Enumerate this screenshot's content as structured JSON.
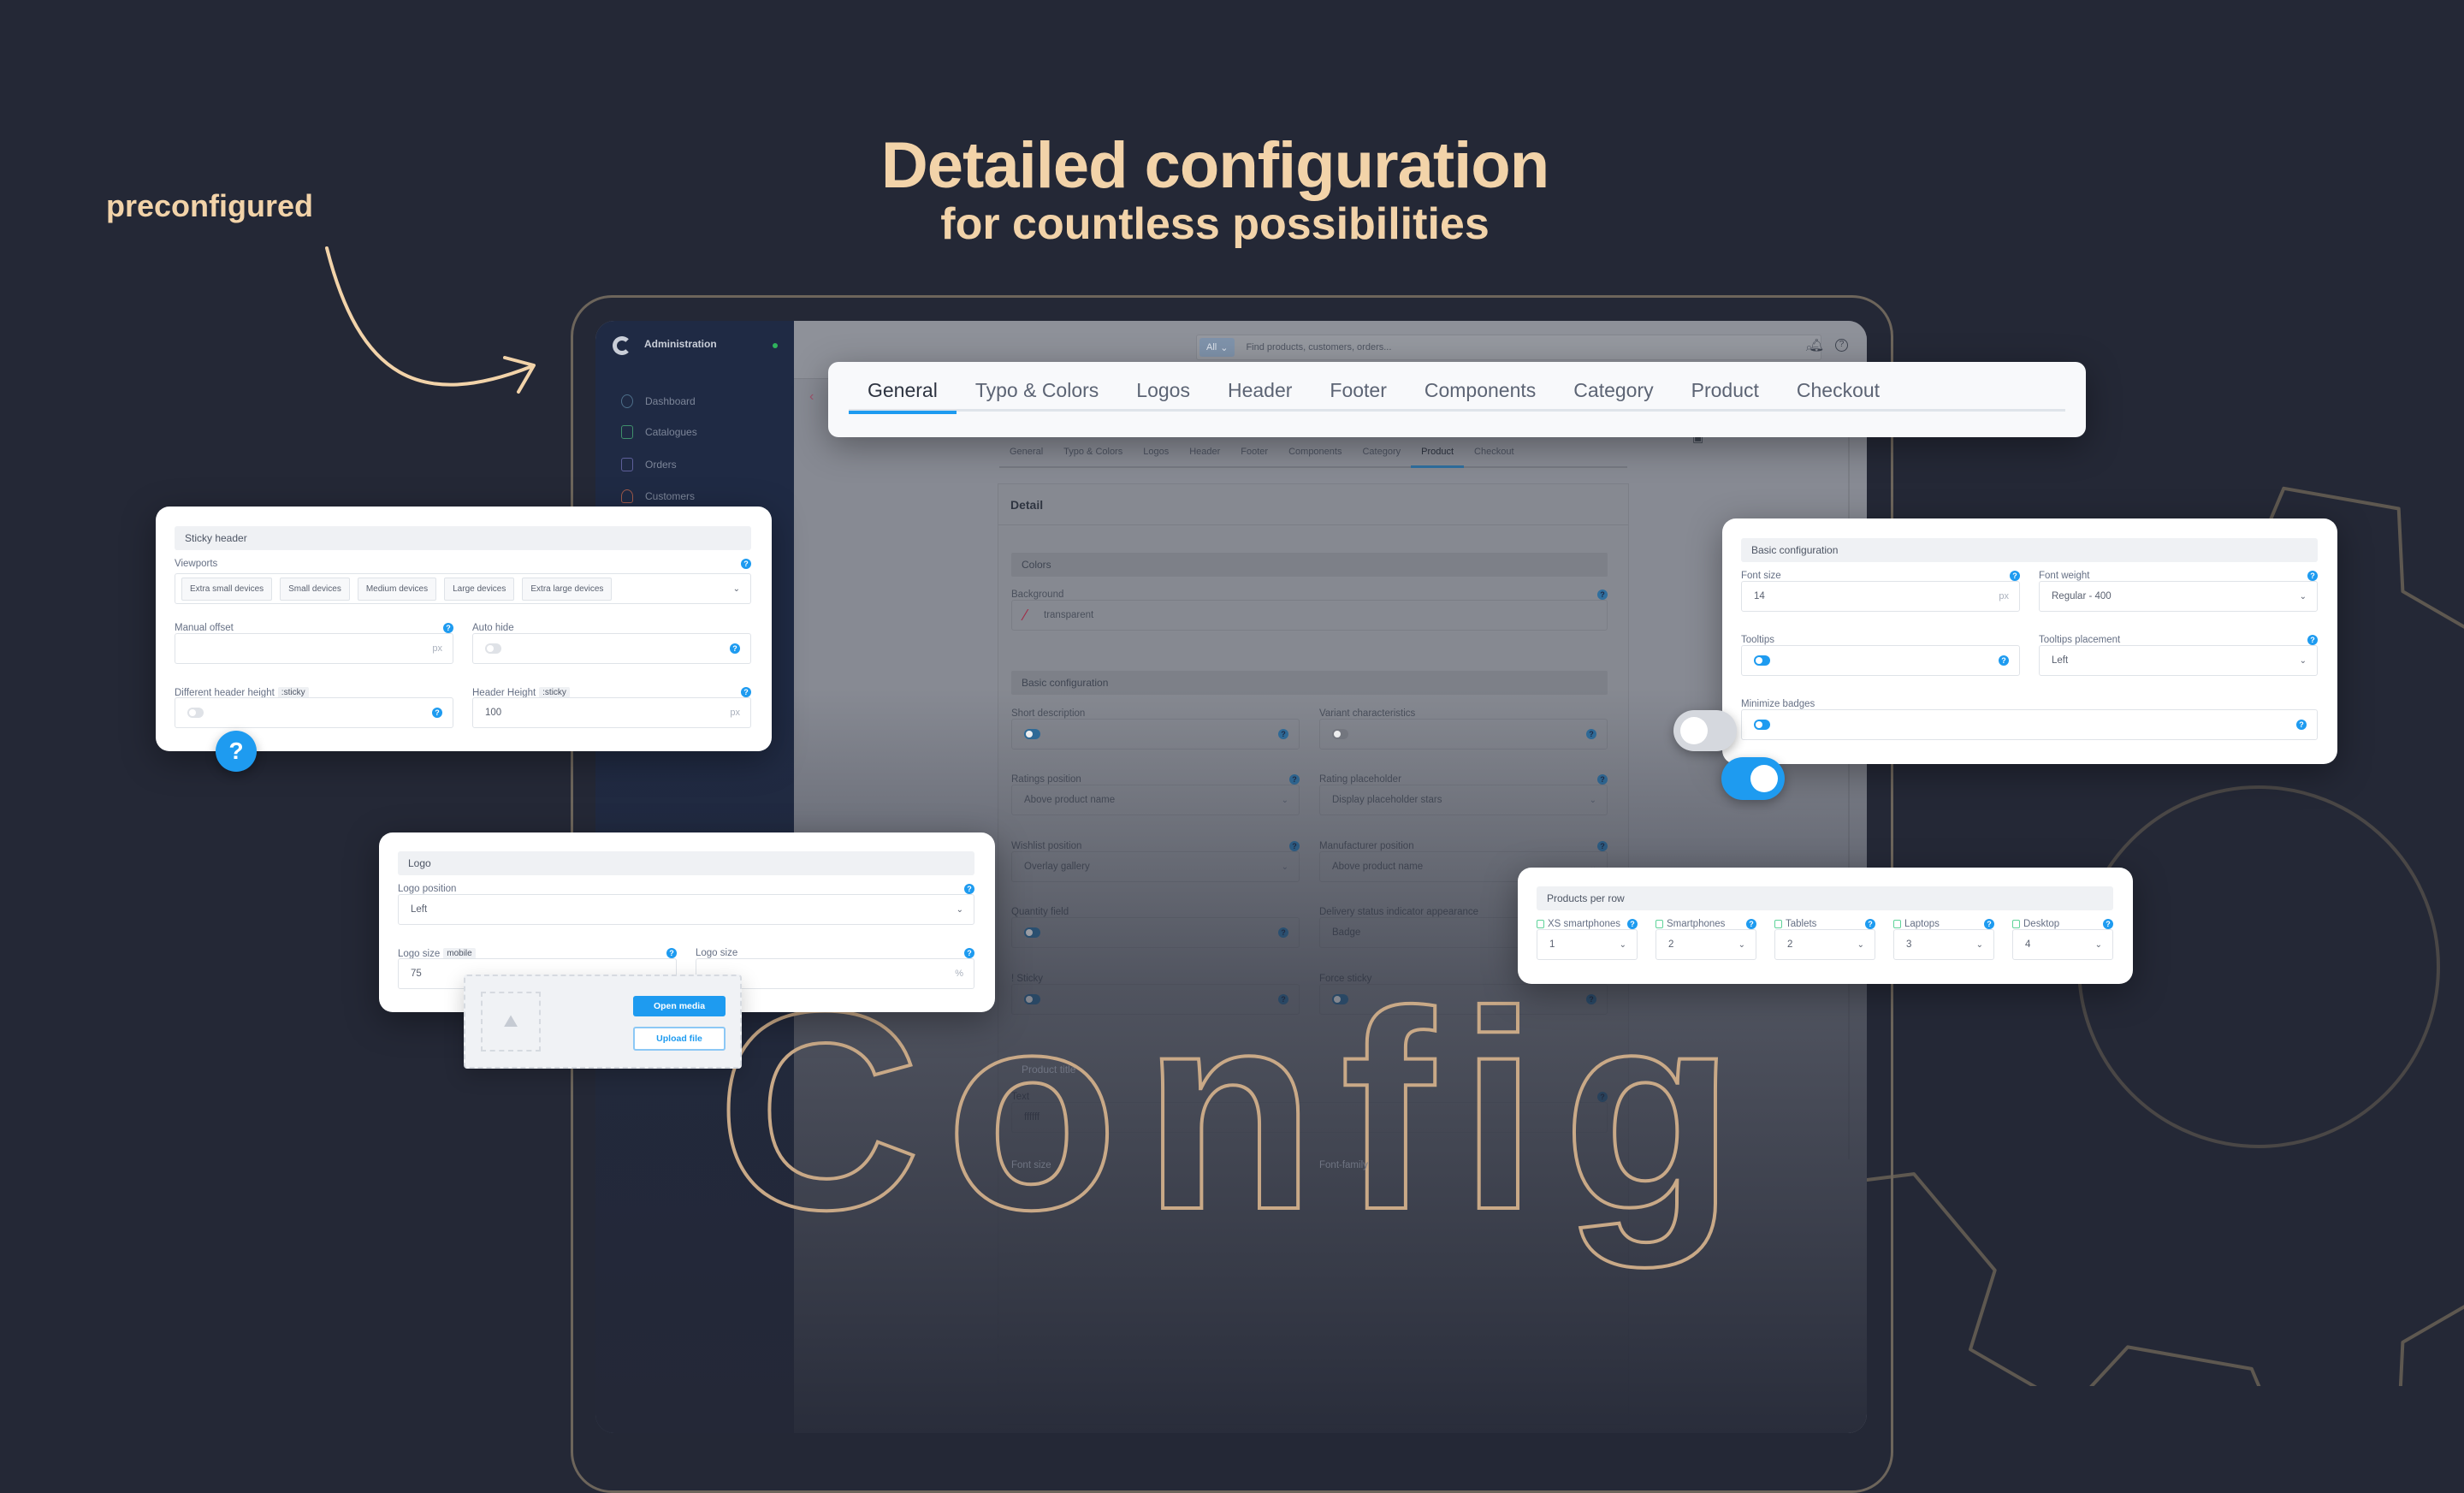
{
  "hero": {
    "tagline": "preconfigured",
    "title": "Detailed configuration",
    "subtitle": "for countless possibilities",
    "watermark": "Config"
  },
  "colors": {
    "background": "#242836",
    "accent_tan": "#f2d3a9",
    "outline": "#c9a987",
    "primary_blue": "#1e9bf0",
    "sidebar": "#1f2a44"
  },
  "admin": {
    "title": "Administration",
    "search_scope": "All",
    "search_placeholder": "Find products, customers, orders...",
    "sidebar": [
      {
        "label": "Dashboard",
        "icon": "gauge-icon"
      },
      {
        "label": "Catalogues",
        "icon": "catalogue-icon"
      },
      {
        "label": "Orders",
        "icon": "clipboard-icon"
      },
      {
        "label": "Customers",
        "icon": "users-icon"
      }
    ],
    "tabs": [
      "General",
      "Typo & Colors",
      "Logos",
      "Header",
      "Footer",
      "Components",
      "Category",
      "Product",
      "Checkout"
    ],
    "active_tab": "Product",
    "detail": {
      "heading": "Detail",
      "colors_section": "Colors",
      "background": {
        "label": "Background",
        "type": "input",
        "value": "transparent",
        "help": "label"
      },
      "basic_section": "Basic configuration",
      "fields": [
        {
          "label": "Short description",
          "type": "toggle",
          "on": true,
          "help": "box"
        },
        {
          "label": "Variant characteristics",
          "type": "toggle",
          "on": false,
          "help": "box"
        },
        {
          "label": "Ratings position",
          "type": "select",
          "value": "Above product name",
          "help": "label"
        },
        {
          "label": "Rating placeholder",
          "type": "select",
          "value": "Display placeholder stars",
          "help": "label"
        },
        {
          "label": "Wishlist position",
          "type": "select",
          "value": "Overlay gallery",
          "help": "label"
        },
        {
          "label": "Manufacturer position",
          "type": "select",
          "value": "Above product name",
          "help": "label"
        },
        {
          "label": "Quantity field",
          "type": "toggle",
          "on": true,
          "help": "box"
        },
        {
          "label": "Delivery status indicator appearance",
          "type": "input",
          "value": "Badge"
        },
        {
          "label": "! Sticky",
          "type": "toggle",
          "on": true,
          "help": "box"
        },
        {
          "label": "Force sticky",
          "type": "toggle",
          "on": true,
          "help": "box"
        }
      ],
      "product_title_section": "Product title",
      "text_field": {
        "label": "Text",
        "type": "input",
        "value": "ffffff",
        "help": "label"
      },
      "font_size_label": "Font size",
      "font_family_label": "Font-family"
    }
  },
  "tab_card": {
    "tabs": [
      "General",
      "Typo & Colors",
      "Logos",
      "Header",
      "Footer",
      "Components",
      "Category",
      "Product",
      "Checkout"
    ],
    "active": "General"
  },
  "sticky_card": {
    "section": "Sticky header",
    "viewports_label": "Viewports",
    "viewports": [
      "Extra small devices",
      "Small devices",
      "Medium devices",
      "Large devices",
      "Extra large devices"
    ],
    "fields": [
      {
        "label": "Manual offset",
        "type": "input",
        "value": "",
        "unit": "px",
        "help": "label"
      },
      {
        "label": "Auto hide",
        "type": "toggle",
        "on": false,
        "help": "box"
      },
      {
        "label": "Different header height",
        "badge": ":sticky",
        "type": "toggle",
        "on": false,
        "help": "box"
      },
      {
        "label": "Header Height",
        "badge": ":sticky",
        "type": "input",
        "value": "100",
        "unit": "px",
        "help": "label"
      }
    ],
    "help_bubble": "?"
  },
  "basic_card": {
    "section": "Basic configuration",
    "fields": [
      {
        "label": "Font size",
        "type": "input",
        "value": "14",
        "unit": "px",
        "help": "label"
      },
      {
        "label": "Font weight",
        "type": "select",
        "value": "Regular - 400",
        "help": "label"
      },
      {
        "label": "Tooltips",
        "type": "toggle",
        "on": true,
        "help": "box"
      },
      {
        "label": "Tooltips placement",
        "type": "select",
        "value": "Left",
        "help": "label"
      },
      {
        "label": "Minimize badges",
        "type": "toggle",
        "on": true,
        "help": "box"
      }
    ],
    "big_toggles": [
      {
        "on": false
      },
      {
        "on": true
      }
    ]
  },
  "logo_card": {
    "section": "Logo",
    "fields": [
      {
        "label": "Logo position",
        "type": "select",
        "value": "Left",
        "help": "label"
      },
      {
        "label": "Logo size",
        "badge": "mobile",
        "type": "input",
        "value": "75",
        "help": "label"
      },
      {
        "label": "Logo size",
        "type": "input",
        "value": "",
        "unit": "%",
        "help": "label"
      }
    ],
    "media": {
      "open_label": "Open media",
      "upload_label": "Upload file"
    }
  },
  "products_card": {
    "section": "Products per row",
    "fields": [
      {
        "label": "XS smartphones",
        "type": "select",
        "value": "1",
        "help": "label",
        "device": true
      },
      {
        "label": "Smartphones",
        "type": "select",
        "value": "2",
        "help": "label",
        "device": true
      },
      {
        "label": "Tablets",
        "type": "select",
        "value": "2",
        "help": "label",
        "device": true
      },
      {
        "label": "Laptops",
        "type": "select",
        "value": "3",
        "help": "label",
        "device": true
      },
      {
        "label": "Desktop",
        "type": "select",
        "value": "4",
        "help": "label",
        "device": true
      }
    ]
  }
}
